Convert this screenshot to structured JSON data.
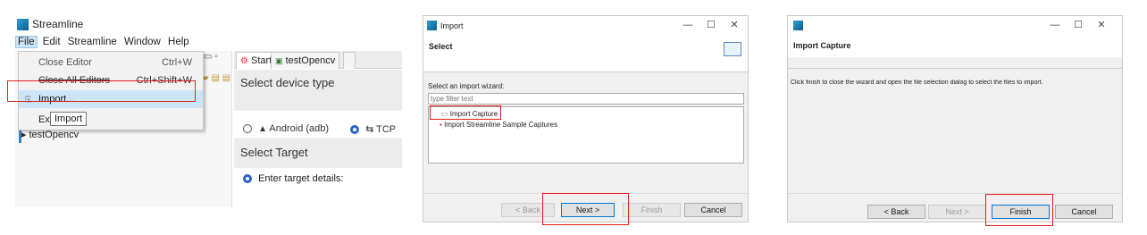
{
  "panel1": {
    "app_title": "Streamline",
    "menu": [
      "File",
      "Edit",
      "Streamline",
      "Window",
      "Help"
    ],
    "file_menu": [
      {
        "label": "Close Editor",
        "shortcut": "Ctrl+W"
      },
      {
        "label": "Close All Editors",
        "shortcut": "Ctrl+Shift+W"
      },
      {
        "label": "Import...",
        "shortcut": ""
      },
      {
        "label": "Exit",
        "shortcut": ""
      }
    ],
    "tooltip": "Import",
    "tree_item": "testOpencv",
    "editor_tabs": [
      "Start",
      "testOpencv"
    ],
    "section_device": "Select device type",
    "android_label": "Android (adb)",
    "tcp_label": "TCP",
    "section_target": "Select Target",
    "enter_target": "Enter target details:"
  },
  "panel2": {
    "window_title": "Import",
    "header_title": "Select",
    "wizard_label": "Select an import wizard:",
    "filter_placeholder": "type filter text",
    "items": [
      "Import Capture",
      "Import Streamline Sample Captures"
    ],
    "buttons": {
      "back": "< Back",
      "next": "Next >",
      "finish": "Finish",
      "cancel": "Cancel"
    }
  },
  "panel3": {
    "header_title": "Import Capture",
    "message": "Click finish to close the wizard and open the file selection dialog to select the files to import.",
    "buttons": {
      "back": "< Back",
      "next": "Next >",
      "finish": "Finish",
      "cancel": "Cancel"
    }
  },
  "colors": {
    "highlight_box": "#e0221e",
    "selection": "#cde6f7",
    "accent": "#0078d7"
  }
}
